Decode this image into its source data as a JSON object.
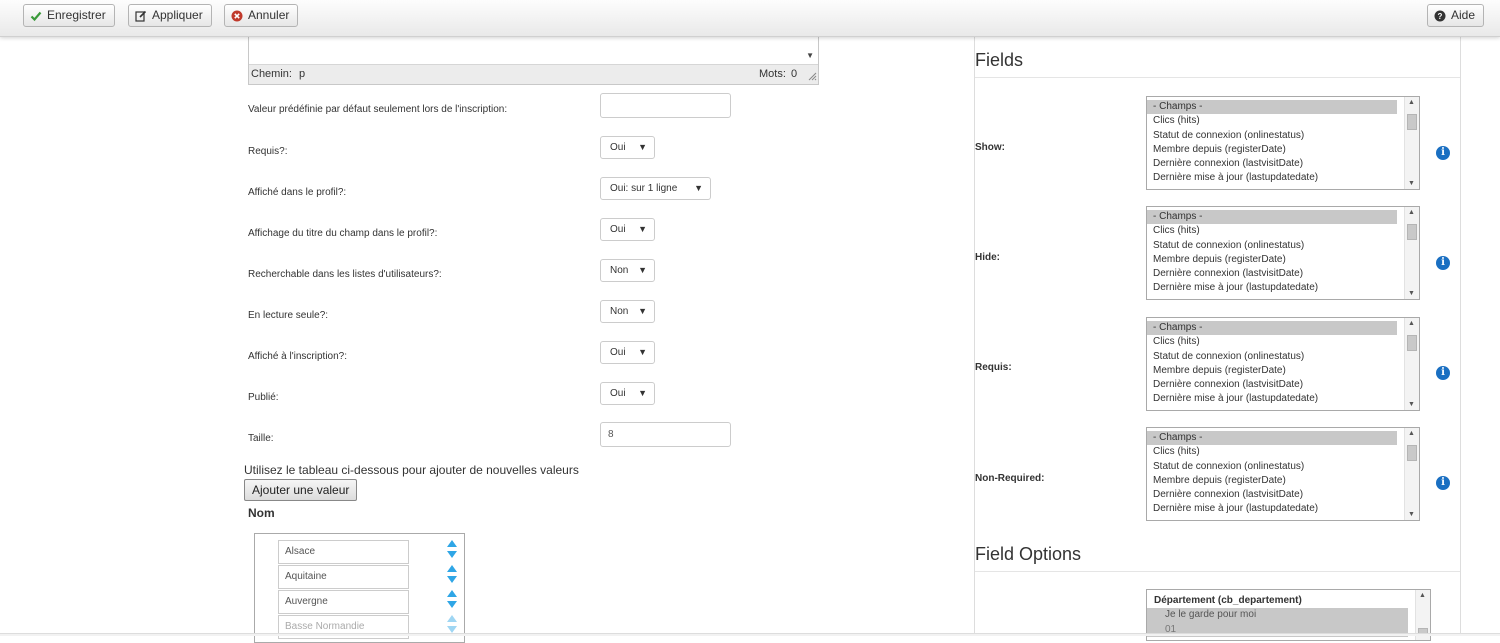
{
  "toolbar": {
    "save_label": "Enregistrer",
    "apply_label": "Appliquer",
    "cancel_label": "Annuler",
    "help_label": "Aide"
  },
  "editor": {
    "path_label": "Chemin:",
    "path_value": "p",
    "words_label": "Mots:",
    "words_value": "0"
  },
  "form": {
    "default_value_label": "Valeur prédéfinie par défaut seulement lors de l'inscription:",
    "default_value": "",
    "required_label": "Requis?:",
    "required_value": "Oui",
    "profile_display_label": "Affiché dans le profil?:",
    "profile_display_value": "Oui: sur 1 ligne",
    "title_display_label": "Affichage du titre du champ dans le profil?:",
    "title_display_value": "Oui",
    "searchable_label": "Recherchable dans les listes d'utilisateurs?:",
    "searchable_value": "Non",
    "readonly_label": "En lecture seule?:",
    "readonly_value": "Non",
    "registration_label": "Affiché à l'inscription?:",
    "registration_value": "Oui",
    "published_label": "Publié:",
    "published_value": "Oui",
    "size_label": "Taille:",
    "size_value": "8"
  },
  "values": {
    "hint": "Utilisez le tableau ci-dessous pour ajouter de nouvelles valeurs",
    "add_button": "Ajouter une valeur",
    "column_header": "Nom",
    "items": [
      "Alsace",
      "Aquitaine",
      "Auvergne",
      "Basse Normandie"
    ]
  },
  "fields_panel": {
    "title": "Fields",
    "groups": [
      {
        "label": "Show:"
      },
      {
        "label": "Hide:"
      },
      {
        "label": "Requis:"
      },
      {
        "label": "Non-Required:"
      }
    ],
    "options": [
      "- Champs -",
      "Clics (hits)",
      "Statut de connexion (onlinestatus)",
      "Membre depuis (registerDate)",
      "Dernière connexion (lastvisitDate)",
      "Dernière mise à jour (lastupdatedate)"
    ]
  },
  "field_options": {
    "title": "Field Options",
    "group_header": "Département (cb_departement)",
    "items": [
      "Je le garde pour moi",
      "01"
    ]
  },
  "colors": {
    "info_icon": "#1a6fc2",
    "save_icon": "#3a9a3a",
    "cancel_icon": "#c0392b"
  }
}
